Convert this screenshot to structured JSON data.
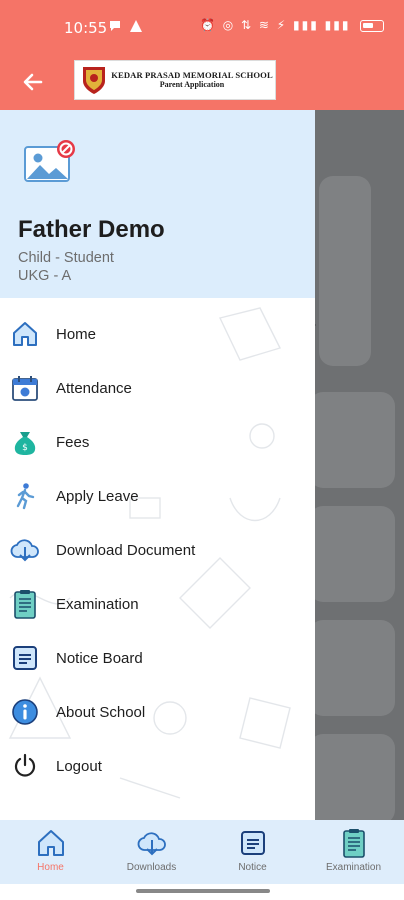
{
  "status_bar": {
    "time": "10:55",
    "left_icons": [
      "chat-bubble-icon",
      "warning-triangle-icon"
    ],
    "right_text": "⏰ ◎ ⇅ ≋ ⚡ ▮▮▮ ▮▮▮",
    "battery_level": 0.4
  },
  "app_bar": {
    "back_icon": "arrow-left-icon",
    "school_name": "KEDAR PRASAD MEMORIAL SCHOOL",
    "subtitle": "Parent Application",
    "background_color": "#f57467"
  },
  "drawer": {
    "header_color": "#dcedfc",
    "avatar_icon": "image-unavailable-icon",
    "parent_name": "Father Demo",
    "child_label": "Child - Student",
    "class_label": "UKG - A",
    "menu": [
      {
        "label": "Home",
        "icon": "home-icon"
      },
      {
        "label": "Attendance",
        "icon": "calendar-icon"
      },
      {
        "label": "Fees",
        "icon": "money-bag-icon"
      },
      {
        "label": "Apply Leave",
        "icon": "walking-person-icon"
      },
      {
        "label": "Download Document",
        "icon": "cloud-download-icon"
      },
      {
        "label": "Examination",
        "icon": "exam-sheet-icon"
      },
      {
        "label": "Notice Board",
        "icon": "notice-board-icon"
      },
      {
        "label": "About School",
        "icon": "info-icon"
      },
      {
        "label": "Logout",
        "icon": "power-icon"
      }
    ]
  },
  "bottom_nav": {
    "active_color": "#f57467",
    "items": [
      {
        "label": "Home",
        "icon": "home-icon",
        "active": true
      },
      {
        "label": "Downloads",
        "icon": "cloud-download-icon",
        "active": false
      },
      {
        "label": "Notice",
        "icon": "notice-board-icon",
        "active": false
      },
      {
        "label": "Examination",
        "icon": "exam-sheet-icon",
        "active": false
      }
    ]
  }
}
